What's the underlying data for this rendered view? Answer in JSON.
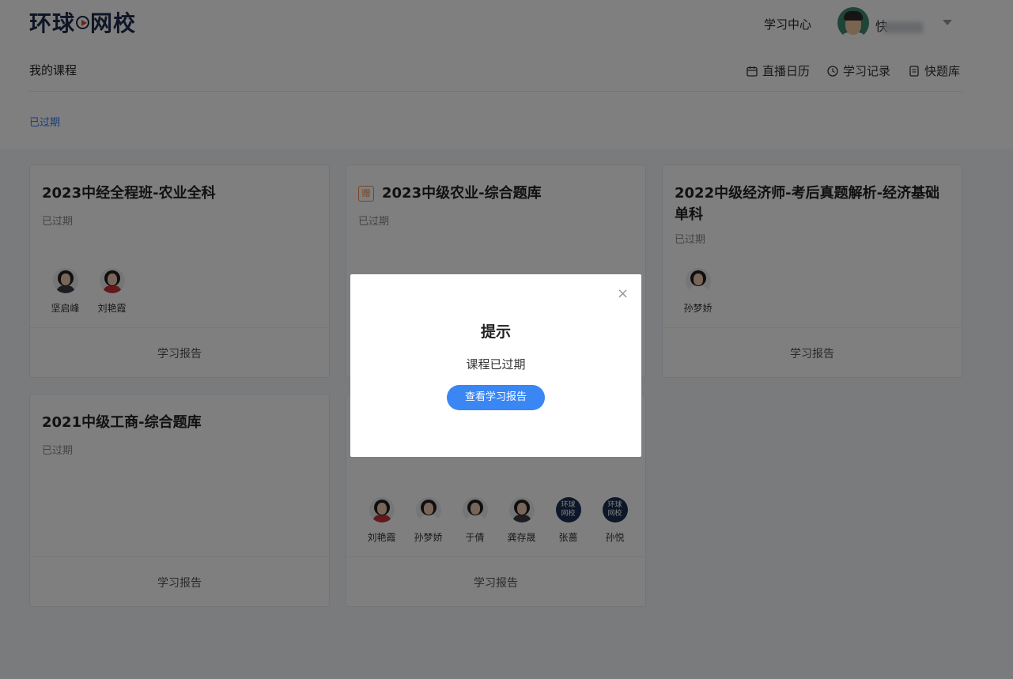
{
  "header": {
    "logo_text": [
      "环球",
      "网校"
    ],
    "study_center": "学习中心",
    "username": "快"
  },
  "subnav": {
    "my_courses": "我的课程",
    "tools": [
      {
        "label": "直播日历",
        "icon": "calendar-icon"
      },
      {
        "label": "学习记录",
        "icon": "clock-icon"
      },
      {
        "label": "快题库",
        "icon": "question-bank-icon"
      }
    ],
    "filter": "已过期"
  },
  "cards": [
    {
      "title": "2023中经全程班-农业全科",
      "status": "已过期",
      "gift": false,
      "teachers": [
        {
          "name": "坚启峰",
          "avatar": "dark"
        },
        {
          "name": "刘艳霞",
          "avatar": "red"
        }
      ],
      "report": "学习报告"
    },
    {
      "title": "2023中级农业-综合题库",
      "status": "已过期",
      "gift": true,
      "gift_label": "赠",
      "teachers": [],
      "report": "学习报告"
    },
    {
      "title": "2022中级经济师-考后真题解析-经济基础单科",
      "status": "已过期",
      "gift": false,
      "teachers": [
        {
          "name": "孙梦娇",
          "avatar": "white"
        }
      ],
      "report": "学习报告"
    },
    {
      "title": "2021中级工商-综合题库",
      "status": "已过期",
      "gift": false,
      "teachers": [],
      "report": "学习报告"
    },
    {
      "title": "",
      "status": "",
      "gift": false,
      "teachers": [
        {
          "name": "刘艳霞",
          "avatar": "red"
        },
        {
          "name": "孙梦娇",
          "avatar": "white"
        },
        {
          "name": "于倩",
          "avatar": "white"
        },
        {
          "name": "龚存晟",
          "avatar": "dark"
        },
        {
          "name": "张蔷",
          "avatar": "logo",
          "logo_text": "环球\n网校"
        },
        {
          "name": "孙悦",
          "avatar": "logo",
          "logo_text": "环球\n网校"
        }
      ],
      "report": "学习报告"
    }
  ],
  "modal": {
    "title": "提示",
    "message": "课程已过期",
    "button": "查看学习报告",
    "close_glyph": "×"
  },
  "colors": {
    "accent": "#3a86f5",
    "link": "#2e7cf6",
    "gift": "#f08a4b"
  }
}
